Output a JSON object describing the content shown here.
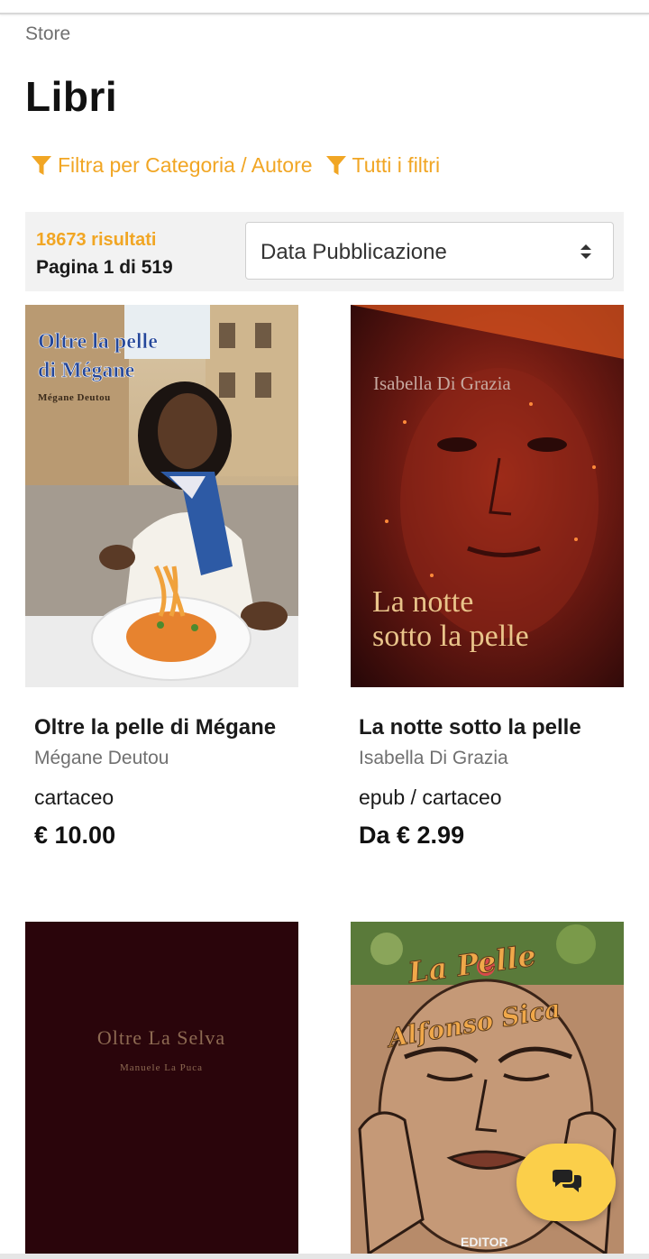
{
  "breadcrumb": "Store",
  "page_title": "Libri",
  "filters": {
    "category_author": "Filtra per Categoria / Autore",
    "all_filters": "Tutti i filtri",
    "icon": "funnel-icon",
    "color": "#f1a624"
  },
  "results": {
    "count": "18673 risultati",
    "page": "Pagina 1 di 519"
  },
  "sort": {
    "selected": "Data Pubblicazione",
    "icon": "sort-arrows-icon"
  },
  "books": [
    {
      "title": "Oltre la pelle di Mégane",
      "author": "Mégane Deutou",
      "format": "cartaceo",
      "price": "€ 10.00",
      "cover_title_line1": "Oltre la pelle",
      "cover_title_line2": "di Mégane",
      "cover_author": "Mégane Deutou"
    },
    {
      "title": "La notte sotto la pelle",
      "author": "Isabella Di Grazia",
      "format": "epub / cartaceo",
      "price": "Da € 2.99",
      "cover_author": "Isabella Di Grazia",
      "cover_title_line1": "La notte",
      "cover_title_line2": "sotto la pelle"
    },
    {
      "cover_title": "Oltre La Selva",
      "cover_author": "Manuele La Puca"
    },
    {
      "cover_title_line1": "La Pelle",
      "cover_author": "Alfonso Sica",
      "cover_publisher": "EDITOR"
    }
  ],
  "chat": {
    "icon": "chat-bubbles-icon",
    "color": "#fbcf4a"
  }
}
